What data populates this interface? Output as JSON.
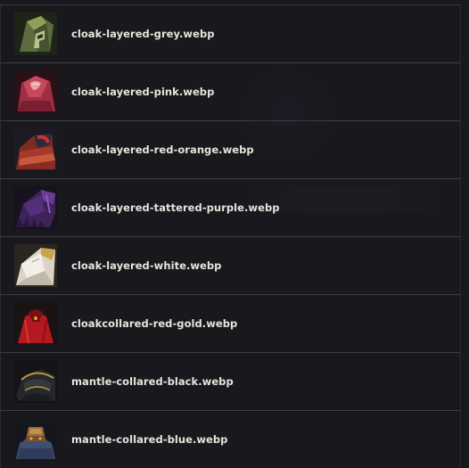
{
  "files": [
    {
      "name": "cloak-layered-grey.webp",
      "icon": "cloak-grey-icon"
    },
    {
      "name": "cloak-layered-pink.webp",
      "icon": "cloak-pink-icon"
    },
    {
      "name": "cloak-layered-red-orange.webp",
      "icon": "cloak-red-orange-icon"
    },
    {
      "name": "cloak-layered-tattered-purple.webp",
      "icon": "cloak-tattered-purple-icon"
    },
    {
      "name": "cloak-layered-white.webp",
      "icon": "cloak-white-icon"
    },
    {
      "name": "cloakcollared-red-gold.webp",
      "icon": "cloak-red-gold-icon"
    },
    {
      "name": "mantle-collared-black.webp",
      "icon": "mantle-black-icon"
    },
    {
      "name": "mantle-collared-blue.webp",
      "icon": "mantle-blue-icon"
    }
  ]
}
